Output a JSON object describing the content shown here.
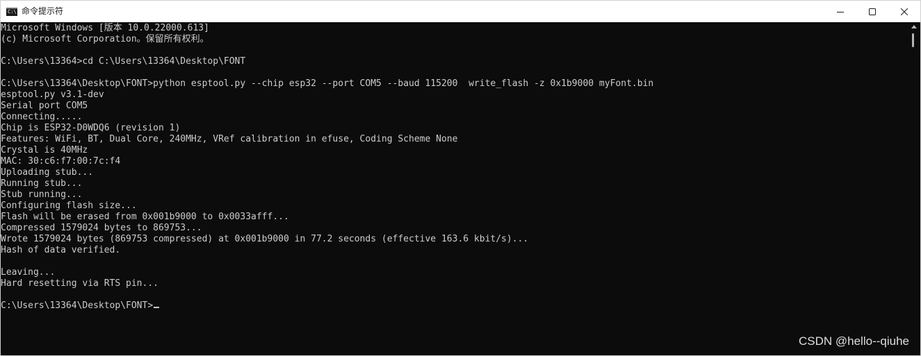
{
  "window": {
    "title": "命令提示符",
    "icon_label": "C:\\",
    "controls": {
      "minimize": "minimize-icon",
      "maximize": "maximize-icon",
      "close": "close-icon"
    }
  },
  "console": {
    "lines": [
      "Microsoft Windows [版本 10.0.22000.613]",
      "(c) Microsoft Corporation。保留所有权利。",
      "",
      "C:\\Users\\13364>cd C:\\Users\\13364\\Desktop\\FONT",
      "",
      "C:\\Users\\13364\\Desktop\\FONT>python esptool.py --chip esp32 --port COM5 --baud 115200  write_flash -z 0x1b9000 myFont.bin",
      "esptool.py v3.1-dev",
      "Serial port COM5",
      "Connecting.....",
      "Chip is ESP32-D0WDQ6 (revision 1)",
      "Features: WiFi, BT, Dual Core, 240MHz, VRef calibration in efuse, Coding Scheme None",
      "Crystal is 40MHz",
      "MAC: 30:c6:f7:00:7c:f4",
      "Uploading stub...",
      "Running stub...",
      "Stub running...",
      "Configuring flash size...",
      "Flash will be erased from 0x001b9000 to 0x0033afff...",
      "Compressed 1579024 bytes to 869753...",
      "Wrote 1579024 bytes (869753 compressed) at 0x001b9000 in 77.2 seconds (effective 163.6 kbit/s)...",
      "Hash of data verified.",
      "",
      "Leaving...",
      "Hard resetting via RTS pin...",
      "",
      "C:\\Users\\13364\\Desktop\\FONT>"
    ]
  },
  "watermark": "CSDN @hello--qiuhe",
  "colors": {
    "console_bg": "#0c0c0c",
    "console_text": "#cccccc",
    "titlebar_bg": "#ffffff"
  }
}
